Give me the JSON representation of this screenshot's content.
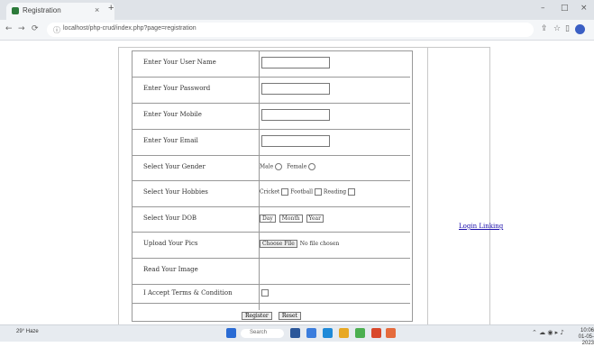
{
  "browser": {
    "tab_title": "Registration",
    "tab_close": "×",
    "new_tab": "+",
    "minimize": "–",
    "maximize": "□",
    "close": "×",
    "back": "←",
    "forward": "→",
    "reload": "⟳",
    "lock": "ⓘ",
    "url": "localhost/php-crud/index.php?page=registration"
  },
  "form": {
    "rows": [
      {
        "label": "Enter Your User Name"
      },
      {
        "label": "Enter Your Password"
      },
      {
        "label": "Enter Your Mobile"
      },
      {
        "label": "Enter Your Email"
      },
      {
        "label": "Select Your Gender",
        "options": [
          "Male",
          "Female"
        ]
      },
      {
        "label": "Select Your Hobbies",
        "options": [
          "Cricket",
          "Football",
          "Reading"
        ]
      },
      {
        "label": "Select Your DOB",
        "selects": [
          "Day",
          "Month",
          "Year"
        ]
      },
      {
        "label": "Upload Your Pics",
        "file_button": "Choose File",
        "file_status": "No file chosen"
      },
      {
        "label": "Read Your Image"
      },
      {
        "label": "I Accept Terms & Condition"
      }
    ],
    "register_button": "Register",
    "reset_button": "Reset"
  },
  "side_link": "Login Linking",
  "taskbar": {
    "weather_temp": "29°",
    "weather_desc": "Haze",
    "search_placeholder": "Search",
    "time": "10:06",
    "date": "01-05-2023"
  }
}
